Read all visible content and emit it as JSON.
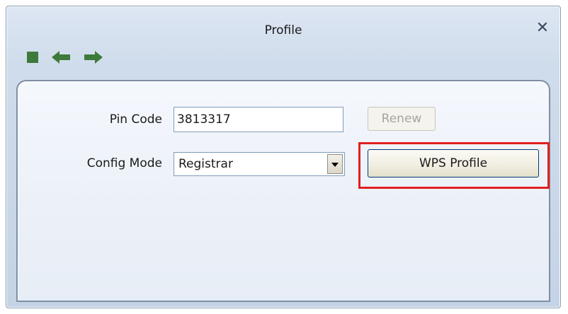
{
  "window": {
    "title": "Profile"
  },
  "toolbar": {
    "icons": [
      "stop-icon",
      "back-arrow-icon",
      "forward-arrow-icon"
    ],
    "icon_color": "#3d7a3b"
  },
  "form": {
    "pin_code_label": "Pin Code",
    "pin_code_value": "3813317",
    "renew_label": "Renew",
    "config_mode_label": "Config Mode",
    "config_mode_value": "Registrar",
    "wps_profile_label": "WPS Profile"
  },
  "colors": {
    "highlight": "#e02020",
    "panel_border": "#7f8fa3",
    "button_border": "#003c74"
  }
}
